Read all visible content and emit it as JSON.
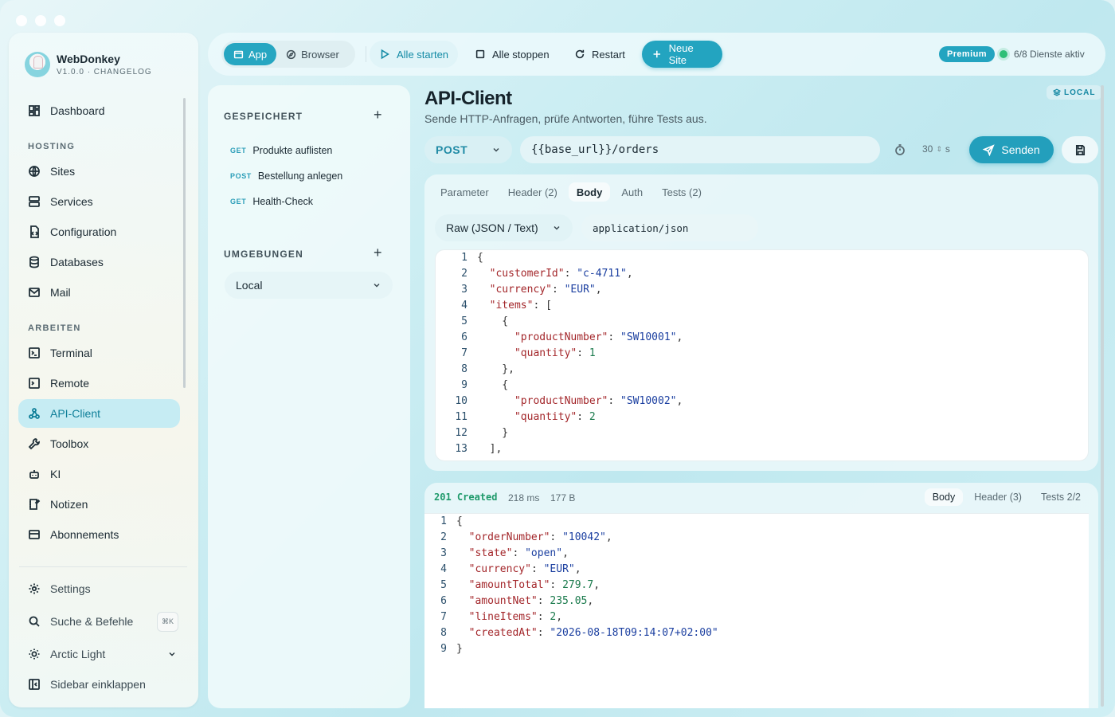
{
  "sidebar": {
    "brand": {
      "name": "WebDonkey",
      "version": "V1.0.0 · CHANGELOG"
    },
    "dashboard": "Dashboard",
    "hosting_label": "HOSTING",
    "hosting": [
      "Sites",
      "Services",
      "Configuration",
      "Databases",
      "Mail"
    ],
    "arbeiten_label": "ARBEITEN",
    "arbeiten": [
      "Terminal",
      "Remote",
      "API-Client",
      "Toolbox",
      "KI",
      "Notizen",
      "Abonnements"
    ],
    "active": "API-Client",
    "footer": {
      "settings": "Settings",
      "search": "Suche & Befehle",
      "search_kbd": "⌘K",
      "theme": "Arctic Light",
      "collapse": "Sidebar einklappen"
    }
  },
  "toolbar": {
    "app": "App",
    "browser": "Browser",
    "start_all": "Alle starten",
    "stop_all": "Alle stoppen",
    "restart": "Restart",
    "new_site": "Neue Site",
    "premium": "Premium",
    "status": "6/8 Dienste aktiv"
  },
  "saved": {
    "header": "GESPEICHERT",
    "requests": [
      {
        "method": "GET",
        "name": "Produkte auflisten"
      },
      {
        "method": "POST",
        "name": "Bestellung anlegen"
      },
      {
        "method": "GET",
        "name": "Health-Check"
      }
    ],
    "env_header": "UMGEBUNGEN",
    "env_selected": "Local"
  },
  "main": {
    "title": "API-Client",
    "subtitle": "Sende HTTP-Anfragen, prüfe Antworten, führe Tests aus.",
    "badge": "LOCAL",
    "method": "POST",
    "url": "{{base_url}}/orders",
    "timeout": "30",
    "timeout_unit": "s",
    "send": "Senden",
    "tabs": [
      "Parameter",
      "Header (2)",
      "Body",
      "Auth",
      "Tests (2)"
    ],
    "active_tab": "Body",
    "body_type": "Raw (JSON / Text)",
    "content_type": "application/json"
  },
  "response": {
    "status": "201 Created",
    "time": "218 ms",
    "size": "177 B",
    "tabs": [
      "Body",
      "Header (3)",
      "Tests 2/2"
    ],
    "active_tab": "Body"
  },
  "colors": {
    "accent": "#23a4c0",
    "success": "#2fbf77",
    "key": "#a3262a",
    "string": "#1b3fa0",
    "number": "#1a7a4c"
  }
}
